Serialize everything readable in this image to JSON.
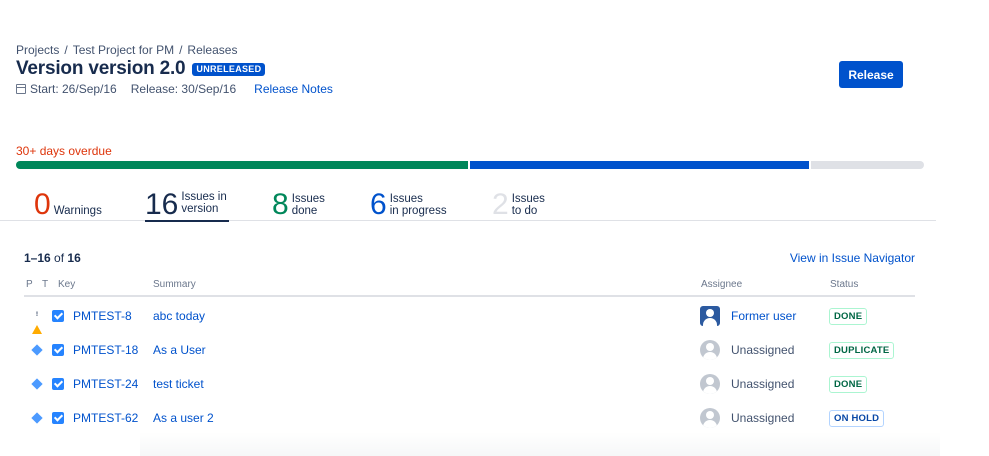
{
  "breadcrumb": [
    "Projects",
    "Test Project for PM",
    "Releases"
  ],
  "breadcrumb_separator": "/",
  "title": "Version version 2.0",
  "status_lozenge": "UNRELEASED",
  "meta": {
    "start": "Start: 26/Sep/16",
    "release": "Release: 30/Sep/16",
    "notes_link": "Release Notes"
  },
  "release_button": "Release",
  "overdue": "30+ days overdue",
  "progress": {
    "done": 8,
    "in_progress": 6,
    "to_do": 2,
    "colors": {
      "done": "#00875a",
      "in_progress": "#0052cc",
      "to_do": "#dfe1e6"
    }
  },
  "stats": {
    "warnings": {
      "num": "0",
      "label": "Warnings"
    },
    "version": {
      "num": "16",
      "label1": "Issues in",
      "label2": "version"
    },
    "done": {
      "num": "8",
      "label1": "Issues",
      "label2": "done"
    },
    "in_progress": {
      "num": "6",
      "label1": "Issues",
      "label2": "in progress"
    },
    "to_do": {
      "num": "2",
      "label1": "Issues",
      "label2": "to do"
    }
  },
  "list": {
    "range": "1–16",
    "of": "of",
    "total": "16",
    "navigator_link": "View in Issue Navigator",
    "columns": {
      "p": "P",
      "t": "T",
      "key": "Key",
      "summary": "Summary",
      "assignee": "Assignee",
      "status": "Status"
    },
    "rows": [
      {
        "priority": "warning-icon",
        "type": "task-icon",
        "key": "PMTEST-8",
        "summary": "abc today",
        "assignee": "Former user",
        "status": "DONE"
      },
      {
        "priority": "diamond-icon",
        "type": "task-icon",
        "key": "PMTEST-18",
        "summary": "As a User",
        "assignee": "Unassigned",
        "status": "DUPLICATE"
      },
      {
        "priority": "diamond-icon",
        "type": "task-icon",
        "key": "PMTEST-24",
        "summary": "test ticket",
        "assignee": "Unassigned",
        "status": "DONE"
      },
      {
        "priority": "diamond-icon",
        "type": "task-icon",
        "key": "PMTEST-62",
        "summary": "As a user 2",
        "assignee": "Unassigned",
        "status": "ON HOLD"
      }
    ]
  },
  "colors": {
    "accent": "#0052cc",
    "danger": "#de350b",
    "success": "#00875a",
    "text": "#172b4d"
  }
}
